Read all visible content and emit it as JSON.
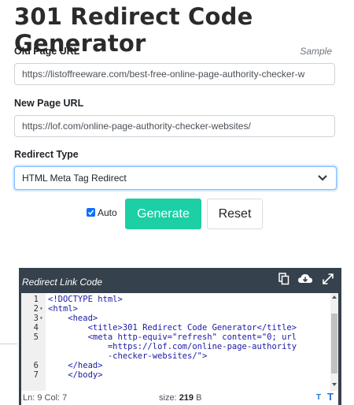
{
  "page": {
    "title": "301 Redirect Code Generator"
  },
  "form": {
    "old_label": "Old Page URL",
    "sample_label": "Sample",
    "old_value": "https://listoffreeware.com/best-free-online-page-authority-checker-w",
    "new_label": "New Page URL",
    "new_value": "https://lof.com/online-page-authority-checker-websites/",
    "type_label": "Redirect Type",
    "type_selected": "HTML Meta Tag Redirect",
    "auto_label": "Auto",
    "auto_checked": true,
    "generate_label": "Generate",
    "reset_label": "Reset"
  },
  "output": {
    "title": "Redirect Link Code",
    "icons": [
      "copy-icon",
      "cloud-download-icon",
      "expand-icon"
    ],
    "lines": [
      {
        "num": "1",
        "fold": "",
        "text": "<!DOCTYPE html>"
      },
      {
        "num": "2",
        "fold": "▾",
        "text": "<html>"
      },
      {
        "num": "3",
        "fold": "▾",
        "text": "    <head>"
      },
      {
        "num": "4",
        "fold": "",
        "text": "        <title>301 Redirect Code Generator</title>"
      },
      {
        "num": "5",
        "fold": "",
        "text": "        <meta http-equiv=\"refresh\" content=\"0; url"
      },
      {
        "num": "",
        "fold": "",
        "text": "            =https://lof.com/online-page-authority"
      },
      {
        "num": "",
        "fold": "",
        "text": "            -checker-websites/\">"
      },
      {
        "num": "6",
        "fold": "",
        "text": "    </head>"
      },
      {
        "num": "7",
        "fold": "",
        "text": "    </body>"
      }
    ],
    "status_position": "Ln: 9 Col: 7",
    "status_size_label": "size: ",
    "status_size_value": "219",
    "status_size_unit": " B",
    "status_t_small": "T",
    "status_t_large": "T"
  },
  "colors": {
    "generate_bg": "#1ccfa5",
    "panel_bg": "#35414c",
    "checkbox": "#0d6efd",
    "select_border": "#80bdff"
  }
}
